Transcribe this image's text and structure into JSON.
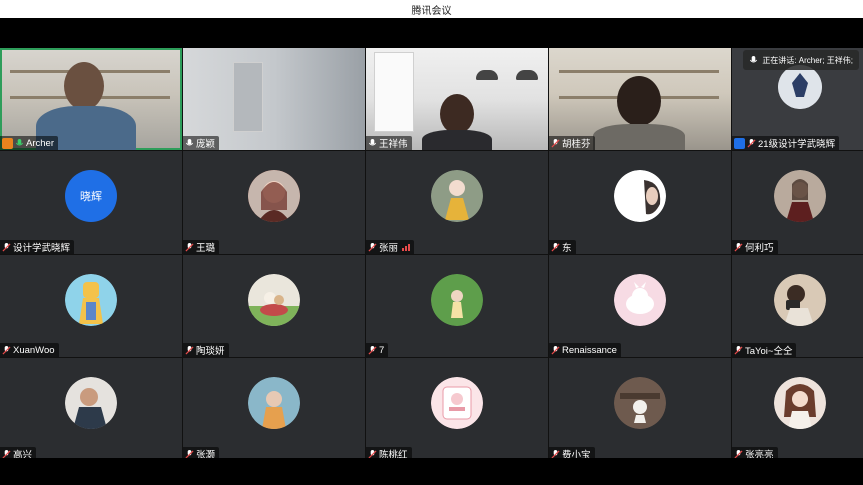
{
  "window": {
    "title": "腾讯会议"
  },
  "speaking": {
    "text": "正在讲话: Archer; 王祥伟;"
  },
  "colors": {
    "tile_bg": "#2b2d30",
    "active_border": "#2e9d5a",
    "host_badge": "#e8831e",
    "cohost_badge": "#1f6fe6",
    "text_avatar_bg": "#1f6fe6"
  },
  "participants": [
    {
      "name": "Archer",
      "type": "video",
      "role": "host",
      "speaking": true
    },
    {
      "name": "庞颖",
      "type": "video"
    },
    {
      "name": "王祥伟",
      "type": "video",
      "speaking": true
    },
    {
      "name": "胡桂芬",
      "type": "video"
    },
    {
      "name": "21级设计学武晓辉",
      "type": "video",
      "role": "cohost"
    },
    {
      "name": "设计学武晓辉",
      "type": "avatar",
      "avatar_text": "晓辉"
    },
    {
      "name": "王璐",
      "type": "avatar"
    },
    {
      "name": "张丽",
      "type": "avatar",
      "signal": true
    },
    {
      "name": "东",
      "type": "avatar"
    },
    {
      "name": "何利巧",
      "type": "avatar"
    },
    {
      "name": "XuanWoo",
      "type": "avatar"
    },
    {
      "name": "陶琰妍",
      "type": "avatar"
    },
    {
      "name": "7",
      "type": "avatar"
    },
    {
      "name": "Renaissance",
      "type": "avatar"
    },
    {
      "name": "TaYoi~仝仝",
      "type": "avatar"
    },
    {
      "name": "高兴",
      "type": "avatar"
    },
    {
      "name": "张灏",
      "type": "avatar"
    },
    {
      "name": "陈桃红",
      "type": "avatar"
    },
    {
      "name": "费小宝",
      "type": "avatar"
    },
    {
      "name": "张亮亮",
      "type": "avatar"
    }
  ]
}
